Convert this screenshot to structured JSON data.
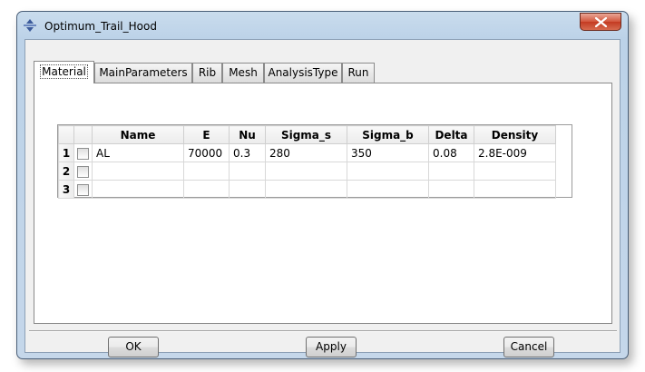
{
  "window": {
    "title": "Optimum_Trail_Hood",
    "close_icon": "close-icon"
  },
  "tabs": [
    "Material",
    "MainParameters",
    "Rib",
    "Mesh",
    "AnalysisType",
    "Run"
  ],
  "active_tab": "Material",
  "table": {
    "columns": [
      "",
      "",
      "Name",
      "E",
      "Nu",
      "Sigma_s",
      "Sigma_b",
      "Delta",
      "Density"
    ],
    "rows": [
      {
        "index": "1",
        "checked": false,
        "name": "AL",
        "E": "70000",
        "Nu": "0.3",
        "Sigma_s": "280",
        "Sigma_b": "350",
        "Delta": "0.08",
        "Density": "2.8E-009"
      },
      {
        "index": "2",
        "checked": false,
        "name": "",
        "E": "",
        "Nu": "",
        "Sigma_s": "",
        "Sigma_b": "",
        "Delta": "",
        "Density": ""
      },
      {
        "index": "3",
        "checked": false,
        "name": "",
        "E": "",
        "Nu": "",
        "Sigma_s": "",
        "Sigma_b": "",
        "Delta": "",
        "Density": ""
      }
    ]
  },
  "buttons": {
    "ok": "OK",
    "apply": "Apply",
    "cancel": "Cancel"
  },
  "colors": {
    "frame": "#bcd2e8",
    "close": "#c33b22"
  }
}
